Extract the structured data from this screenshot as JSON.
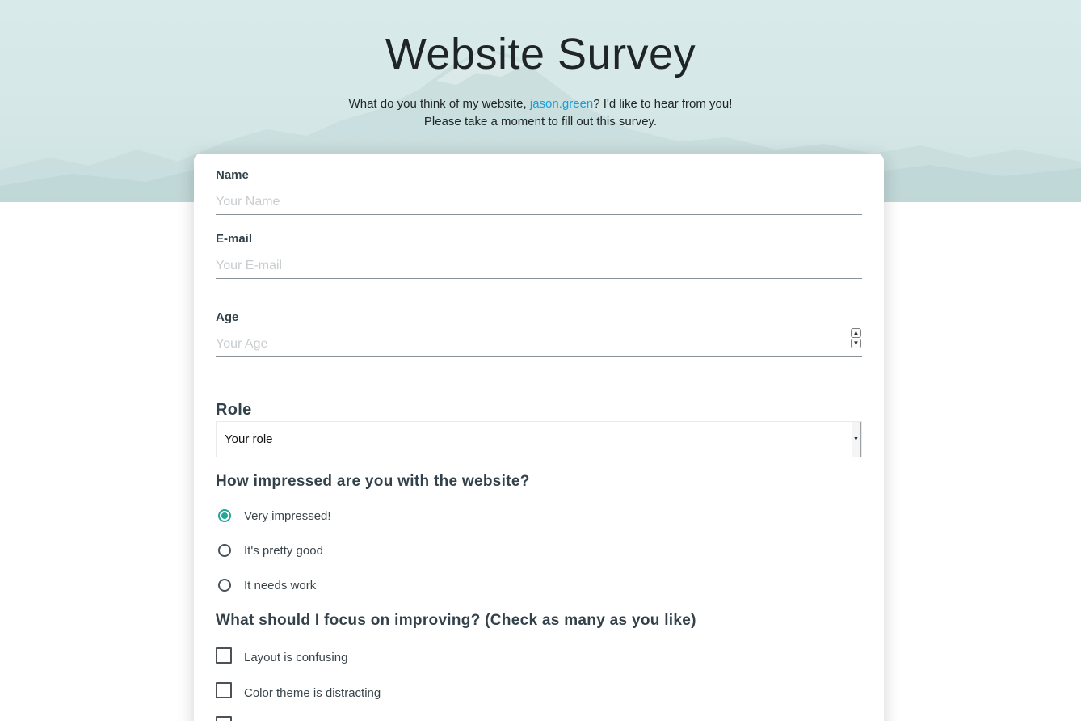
{
  "header": {
    "title": "Website Survey",
    "intro_before": "What do you think of my website, ",
    "username": "jason.green",
    "intro_after": "? I'd like to hear from you!",
    "intro_line2": "Please take a moment to fill out this survey."
  },
  "form": {
    "name": {
      "label": "Name",
      "placeholder": "Your Name"
    },
    "email": {
      "label": "E-mail",
      "placeholder": "Your E-mail"
    },
    "age": {
      "label": "Age",
      "placeholder": "Your Age"
    },
    "role": {
      "title": "Role",
      "selected": "Your role"
    },
    "impression": {
      "question": "How impressed are you with the website?",
      "options": [
        {
          "label": "Very impressed!",
          "checked": true
        },
        {
          "label": "It's pretty good",
          "checked": false
        },
        {
          "label": "It needs work",
          "checked": false
        }
      ]
    },
    "improve": {
      "question": "What should I focus on improving? (Check as many as you like)",
      "options": [
        {
          "label": "Layout is confusing",
          "checked": false
        },
        {
          "label": "Color theme is distracting",
          "checked": false
        },
        {
          "label": "",
          "checked": false
        }
      ]
    }
  },
  "colors": {
    "accent": "#26a69a",
    "link": "#1a9ed6",
    "hero_background": "#d9eaea"
  }
}
